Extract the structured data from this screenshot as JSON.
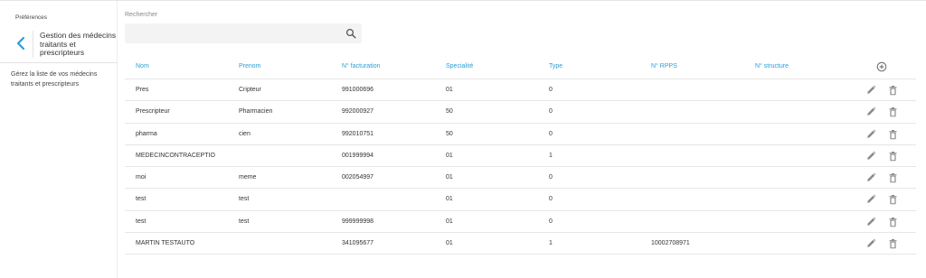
{
  "sidebar": {
    "section_label": "Préférences",
    "title": "Gestion des médecins traitants et prescripteurs",
    "description": "Gérez la liste de vos médecins traitants et prescripteurs",
    "back_icon": "chevron-left-icon"
  },
  "search": {
    "label": "Rechercher",
    "value": "",
    "placeholder": "",
    "icon": "search-icon"
  },
  "table": {
    "headers": [
      "Nom",
      "Prenom",
      "N° facturation",
      "Specialité",
      "Type",
      "N° RPPS",
      "N° structure"
    ],
    "rows": [
      [
        "Pres",
        "Cripteur",
        "991000696",
        "01",
        "0",
        "",
        ""
      ],
      [
        "Prescripteur",
        "Pharmacien",
        "992000927",
        "50",
        "0",
        "",
        ""
      ],
      [
        "pharma",
        "cien",
        "992010751",
        "50",
        "0",
        "",
        ""
      ],
      [
        "MEDECINCONTRACEPTIO",
        "",
        "001999994",
        "01",
        "1",
        "",
        ""
      ],
      [
        "moi",
        "meme",
        "002054997",
        "01",
        "0",
        "",
        ""
      ],
      [
        "test",
        "test",
        "",
        "01",
        "0",
        "",
        ""
      ],
      [
        "test",
        "test",
        "999999998",
        "01",
        "0",
        "",
        ""
      ],
      [
        "MARTIN TESTAUTO",
        "",
        "341095677",
        "01",
        "1",
        "10002708971",
        ""
      ]
    ]
  },
  "colors": {
    "accent": "#2a9fd6",
    "icon_gray": "#8a8a8a",
    "search_bg": "#f3f3f3"
  }
}
